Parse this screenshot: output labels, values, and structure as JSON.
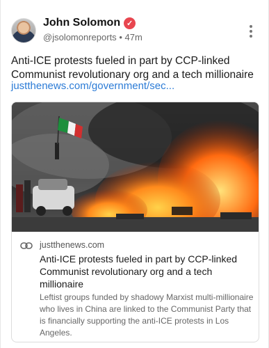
{
  "post": {
    "author_name": "John Solomon",
    "handle": "@jsolomonreports",
    "separator": "•",
    "time": "47m",
    "text": "Anti-ICE protests fueled in part by CCP-linked Communist revolutionary org and a tech millionaire",
    "link_text": "justthenews.com/government/sec..."
  },
  "link_card": {
    "domain": "justthenews.com",
    "title": "Anti-ICE protests fueled in part by CCP-linked Communist revolutionary org and a tech millionaire",
    "description": "Leftist groups funded by shadowy Marxist multi-millionaire who lives in China are linked to the Communist Party that is financially supporting the anti-ICE protests in Los Angeles."
  },
  "icons": {
    "verified": "verified-badge-icon",
    "more": "more-options-icon",
    "link": "link-icon"
  },
  "colors": {
    "verified_badge": "#e8464f",
    "link": "#2b7bd6",
    "secondary_text": "#666666"
  }
}
